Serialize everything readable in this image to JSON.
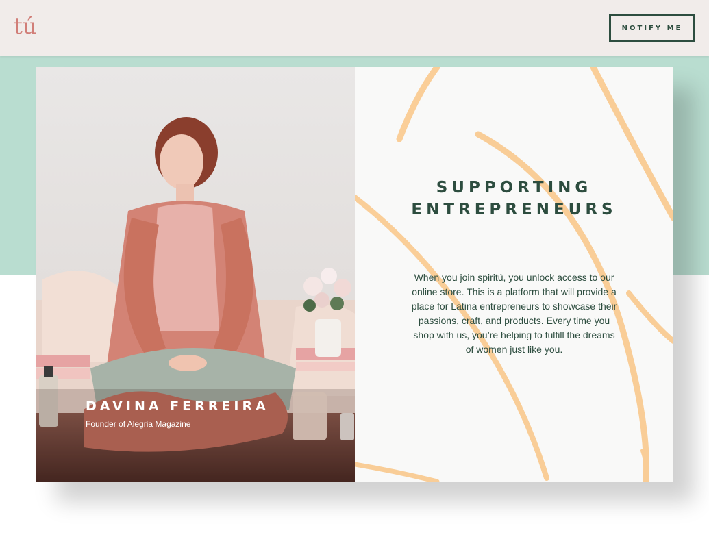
{
  "header": {
    "logo_text": "tú",
    "notify_label": "NOTIFY ME"
  },
  "feature": {
    "photo_name": "DAVINA FERREIRA",
    "photo_caption": "Founder of Alegria Magazine",
    "heading_line1": "SUPPORTING",
    "heading_line2": "ENTREPRENEURS",
    "body": "When you join spiritú, you unlock access to our online store. This is a platform that will provide a place for Latina entrepreneurs to showcase their passions, craft, and products. Every time you shop with us, you’re helping to fulfill the dreams of women just like you."
  },
  "colors": {
    "header_bg": "#f1ecea",
    "brand_pink": "#d17e78",
    "brand_green": "#2d4d3f",
    "mint": "#b9ddd0",
    "stroke_orange": "#f9c98d"
  }
}
